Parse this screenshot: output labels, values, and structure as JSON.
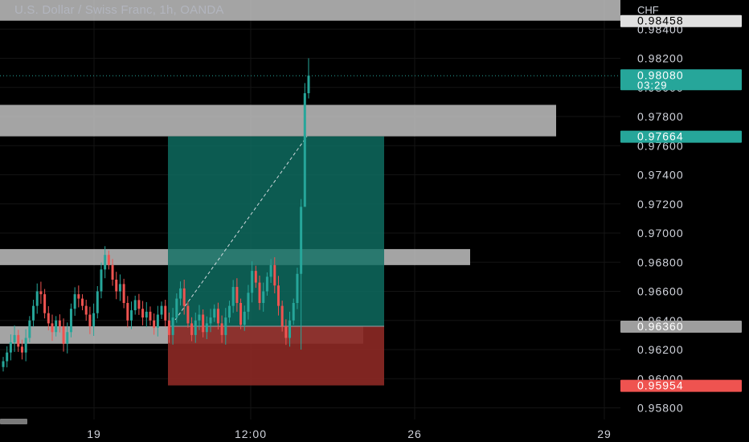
{
  "header": {
    "title": "U.S. Dollar / Swiss Franc, 1h, OANDA"
  },
  "price_axis": {
    "currency": "CHF"
  },
  "colors": {
    "bull": "#26a69a",
    "bear": "#ef5350",
    "zone": "#c8c8c8",
    "profit": "#0f6f63",
    "loss": "#8a2824",
    "axis_text": "#d1d4dc",
    "grid": "#141414"
  },
  "chart_data": {
    "type": "candlestick",
    "title": "U.S. Dollar / Swiss Franc, 1h, OANDA",
    "ylabel": "CHF",
    "ylim": [
      0.9572,
      0.986
    ],
    "y_ticks": [
      "0.95800",
      "0.96000",
      "0.96200",
      "0.96400",
      "0.96600",
      "0.96800",
      "0.97000",
      "0.97200",
      "0.97400",
      "0.97600",
      "0.97800",
      "0.98000",
      "0.98200",
      "0.98400"
    ],
    "x_ticks": [
      "19",
      "12:00",
      "26",
      "29"
    ],
    "price_labels": [
      {
        "value": "0.98458",
        "kind": "zone"
      },
      {
        "value": "0.98080",
        "countdown": "03:29",
        "kind": "last"
      },
      {
        "value": "0.97664",
        "kind": "target"
      },
      {
        "value": "0.96360",
        "kind": "entry"
      },
      {
        "value": "0.95954",
        "kind": "stop"
      }
    ],
    "last_price": 0.9808,
    "position": {
      "side": "long",
      "entry": 0.9636,
      "target": 0.97664,
      "stop": 0.95954
    },
    "zones": [
      {
        "low": 0.97664,
        "high": 0.9788
      },
      {
        "low": 0.9678,
        "high": 0.9689
      },
      {
        "low": 0.9624,
        "high": 0.9636
      },
      {
        "low": 0.98458,
        "high": 0.988
      }
    ],
    "path": [
      0.9612,
      0.9618,
      0.9625,
      0.963,
      0.9622,
      0.9618,
      0.9628,
      0.964,
      0.965,
      0.966,
      0.9658,
      0.9645,
      0.9638,
      0.9632,
      0.964,
      0.9636,
      0.9624,
      0.9632,
      0.9648,
      0.9658,
      0.9655,
      0.965,
      0.9644,
      0.9636,
      0.9645,
      0.966,
      0.9675,
      0.9685,
      0.9678,
      0.9668,
      0.966,
      0.9665,
      0.9652,
      0.964,
      0.9647,
      0.9654,
      0.9648,
      0.9642,
      0.9646,
      0.964,
      0.9635,
      0.9644,
      0.965,
      0.964,
      0.963,
      0.9642,
      0.9655,
      0.9662,
      0.965,
      0.9638,
      0.963,
      0.964,
      0.9644,
      0.9632,
      0.9638,
      0.9642,
      0.9648,
      0.9638,
      0.963,
      0.9642,
      0.965,
      0.9663,
      0.9652,
      0.9637,
      0.9646,
      0.9659,
      0.9674,
      0.9666,
      0.9652,
      0.966,
      0.967,
      0.9678,
      0.9664,
      0.965,
      0.9636,
      0.9628,
      0.964,
      0.9652,
      0.9672,
      0.9718,
      0.9796,
      0.9808
    ]
  }
}
